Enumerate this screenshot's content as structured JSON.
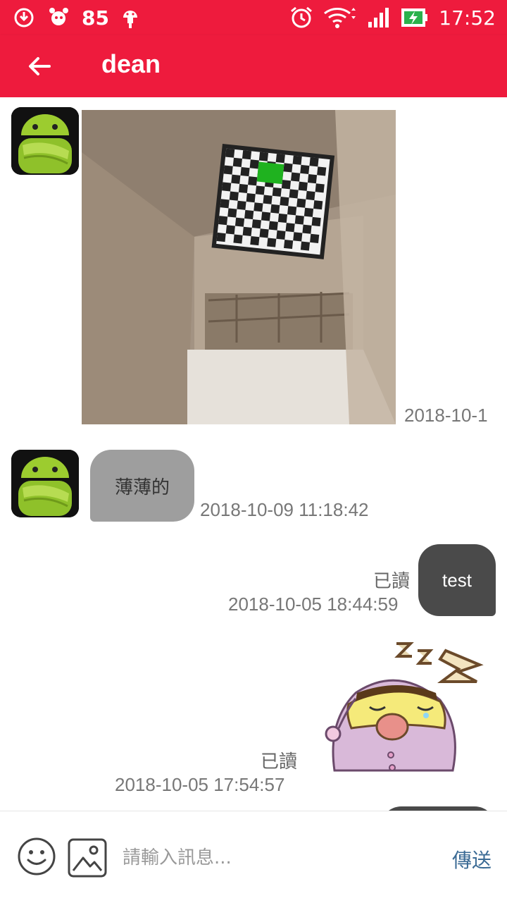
{
  "status_bar": {
    "battery_saver_level": "85",
    "time": "17:52"
  },
  "app_bar": {
    "title": "dean"
  },
  "messages": [
    {
      "type": "image",
      "direction": "incoming",
      "timestamp": "2018-10-1"
    },
    {
      "type": "text",
      "direction": "incoming",
      "text": "薄薄的",
      "timestamp": "2018-10-09 11:18:42"
    },
    {
      "type": "text",
      "direction": "outgoing",
      "text": "test",
      "read_label": "已讀",
      "timestamp": "2018-10-05 18:44:59"
    },
    {
      "type": "sticker",
      "direction": "outgoing",
      "read_label": "已讀",
      "timestamp": "2018-10-05 17:54:57"
    }
  ],
  "input_bar": {
    "placeholder": "請輸入訊息...",
    "send_label": "傳送"
  },
  "colors": {
    "primary": "#ee1b3d",
    "incoming_bubble": "#9e9e9e",
    "outgoing_bubble": "#4a4a4a",
    "send_text": "#3b6b95"
  }
}
